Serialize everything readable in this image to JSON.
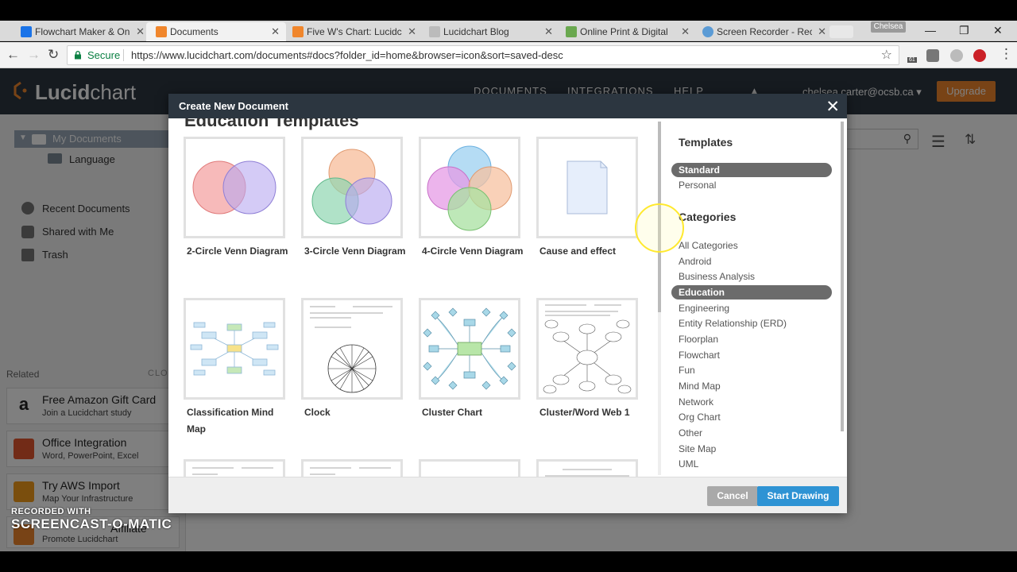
{
  "browser": {
    "tabs": [
      {
        "label": "Flowchart Maker & Onl",
        "favicon_color": "#1a73e8"
      },
      {
        "label": "Documents",
        "favicon_color": "#f0862c"
      },
      {
        "label": "Five W's Chart: Lucidch",
        "favicon_color": "#f0862c"
      },
      {
        "label": "Lucidchart Blog",
        "favicon_color": "#999999"
      },
      {
        "label": "Online Print & Digital",
        "favicon_color": "#6aa84f"
      },
      {
        "label": "Screen Recorder - Rec",
        "favicon_color": "#5b9bd5"
      }
    ],
    "profile_name": "Chelsea",
    "secure_label": "Secure",
    "url": "https://www.lucidchart.com/documents#docs?folder_id=home&browser=icon&sort=saved-desc",
    "extension_badge": "61"
  },
  "lucidchart": {
    "logo_bold": "Lucid",
    "logo_regular": "chart",
    "nav": [
      "DOCUMENTS",
      "INTEGRATIONS",
      "HELP"
    ],
    "user_email": "chelsea.carter@ocsb.ca ▾",
    "upgrade_label": "Upgrade",
    "sidebar": {
      "my_documents": "My Documents",
      "language_folder": "Language",
      "recent": "Recent Documents",
      "shared": "Shared with Me",
      "trash": "Trash",
      "related": "Related",
      "close_related": "CLOSE"
    },
    "promos": [
      {
        "title": "Free Amazon Gift Card",
        "subtitle": "Join a Lucidchart study"
      },
      {
        "title": "Office Integration",
        "subtitle": "Word, PowerPoint, Excel"
      },
      {
        "title": "Try AWS Import",
        "subtitle": "Map Your Infrastructure"
      },
      {
        "title": "Affiliate",
        "subtitle": "Promote Lucidchart"
      }
    ]
  },
  "modal": {
    "title": "Create New Document",
    "gallery_heading": "Education Templates",
    "templates": [
      {
        "label": "2-Circle Venn Diagram"
      },
      {
        "label": "3-Circle Venn Diagram"
      },
      {
        "label": "4-Circle Venn Diagram"
      },
      {
        "label": "Cause and effect"
      },
      {
        "label": "Classification Mind Map"
      },
      {
        "label": "Clock"
      },
      {
        "label": "Cluster Chart"
      },
      {
        "label": "Cluster/Word Web 1"
      }
    ],
    "templates_heading": "Templates",
    "template_sources": [
      "Standard",
      "Personal"
    ],
    "selected_source": "Standard",
    "categories_heading": "Categories",
    "categories": [
      "All Categories",
      "Android",
      "Business Analysis",
      "Education",
      "Engineering",
      "Entity Relationship (ERD)",
      "Floorplan",
      "Flowchart",
      "Fun",
      "Mind Map",
      "Network",
      "Org Chart",
      "Other",
      "Site Map",
      "UML"
    ],
    "selected_category": "Education",
    "cancel_label": "Cancel",
    "start_label": "Start Drawing"
  },
  "watermark": {
    "top": "RECORDED WITH",
    "main": "SCREENCAST-O-MATIC"
  },
  "colors": {
    "accent_orange": "#f0862c",
    "primary_blue": "#2e93d4",
    "header_dark": "#2c3640",
    "selected_grey": "#6b6b6b"
  }
}
